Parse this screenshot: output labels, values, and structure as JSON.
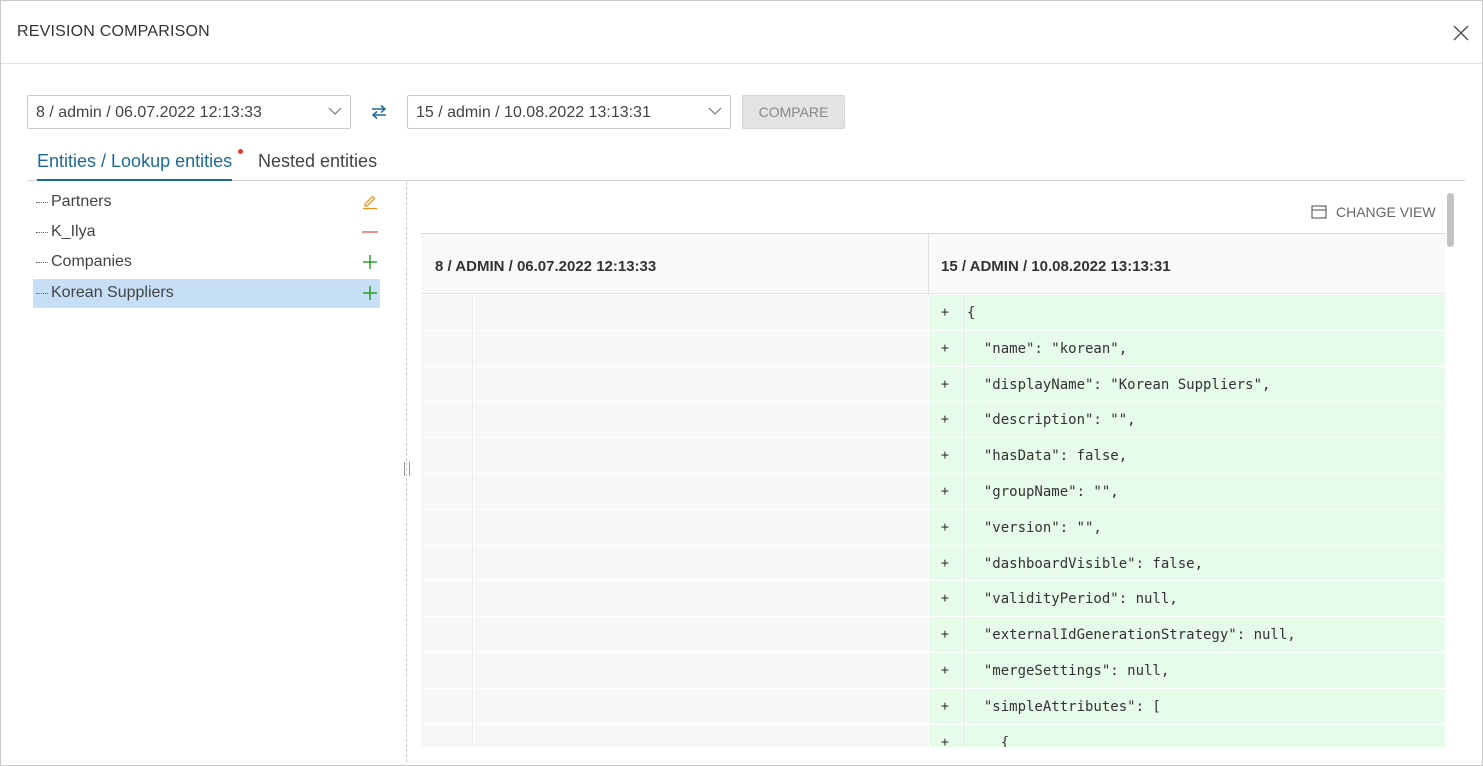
{
  "dialog": {
    "title": "REVISION COMPARISON"
  },
  "controls": {
    "left_revision": "8 / admin / 06.07.2022 12:13:33",
    "right_revision": "15 / admin / 10.08.2022 13:13:31",
    "compare_label": "COMPARE"
  },
  "tabs": [
    {
      "label": "Entities / Lookup entities",
      "active": true,
      "has_changes": true
    },
    {
      "label": "Nested entities",
      "active": false
    }
  ],
  "tree": {
    "items": [
      {
        "label": "Partners",
        "status": "modified",
        "icon": "pencil-icon",
        "color": "#e8911c"
      },
      {
        "label": "K_Ilya",
        "status": "removed",
        "icon": "minus-icon",
        "color": "#e57373"
      },
      {
        "label": "Companies",
        "status": "added",
        "icon": "plus-icon",
        "color": "#2e9b2e"
      },
      {
        "label": "Korean Suppliers",
        "status": "added",
        "icon": "plus-icon",
        "color": "#2e9b2e",
        "selected": true
      }
    ]
  },
  "diff": {
    "change_view_label": "CHANGE VIEW",
    "left_header": "8 / ADMIN / 06.07.2022 12:13:33",
    "right_header": "15 / ADMIN / 10.08.2022 13:13:31",
    "added_marker": "+",
    "lines": [
      "{",
      "  \"name\": \"korean\",",
      "  \"displayName\": \"Korean Suppliers\",",
      "  \"description\": \"\",",
      "  \"hasData\": false,",
      "  \"groupName\": \"\",",
      "  \"version\": \"\",",
      "  \"dashboardVisible\": false,",
      "  \"validityPeriod\": null,",
      "  \"externalIdGenerationStrategy\": null,",
      "  \"mergeSettings\": null,",
      "  \"simpleAttributes\": [",
      "    {"
    ]
  },
  "colors": {
    "accent": "#1e6a96",
    "added_bg": "#e6fbe9",
    "selected_bg": "#c6def6"
  }
}
